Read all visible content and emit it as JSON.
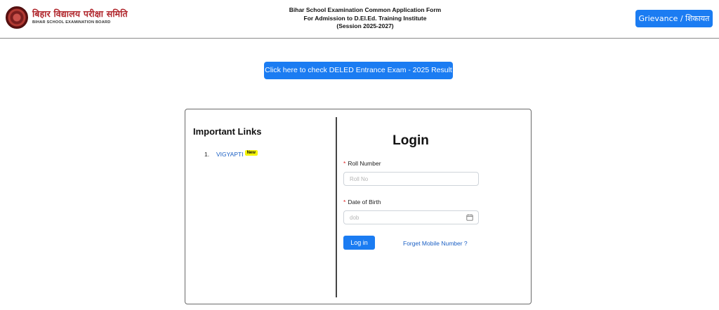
{
  "header": {
    "logo_hindi": "बिहार विद्यालय परीक्षा समिति",
    "logo_english": "BIHAR SCHOOL EXAMINATION BOARD",
    "title_lines": [
      "Bihar School Examination Common Application Form",
      "For Admission to D.El.Ed. Training Institute",
      "(Session 2025-2027)"
    ],
    "grievance_label": "Grievance / शिकायत"
  },
  "result_button_label": "Click here to check DELED Entrance Exam - 2025 Result",
  "important_links": {
    "title": "Important Links",
    "items": [
      {
        "number": "1.",
        "label": "VIGYAPTI",
        "badge": "New"
      }
    ]
  },
  "login": {
    "title": "Login",
    "roll_label": "Roll Number",
    "roll_placeholder": "Roll No",
    "dob_label": "Date of Birth",
    "dob_placeholder": "dob",
    "required_mark": "*",
    "submit_label": "Log in",
    "forget_label": "Forget Mobile Number ?"
  },
  "colors": {
    "primary": "#1b7cf2",
    "link": "#1a5fc4",
    "badge": "#f5f507",
    "required": "#e02020",
    "logo_red": "#b0262c"
  }
}
